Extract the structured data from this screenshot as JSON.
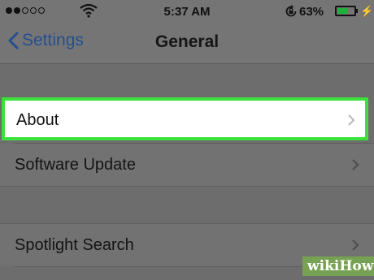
{
  "status_bar": {
    "time": "5:37 AM",
    "battery_percent": "63%",
    "battery_level": 0.63,
    "signal_dots_filled": 2,
    "signal_dots_total": 5,
    "icons": [
      "signal-dots-icon",
      "wifi-icon",
      "rotation-lock-icon",
      "battery-icon",
      "charging-bolt-icon"
    ]
  },
  "nav": {
    "back_label": "Settings",
    "title": "General"
  },
  "rows": [
    {
      "label": "About",
      "highlighted": true
    },
    {
      "label": "Software Update",
      "highlighted": false
    },
    {
      "label": "Spotlight Search",
      "highlighted": false
    }
  ],
  "highlight_color": "#3ce13b",
  "watermark": "wikiHow"
}
